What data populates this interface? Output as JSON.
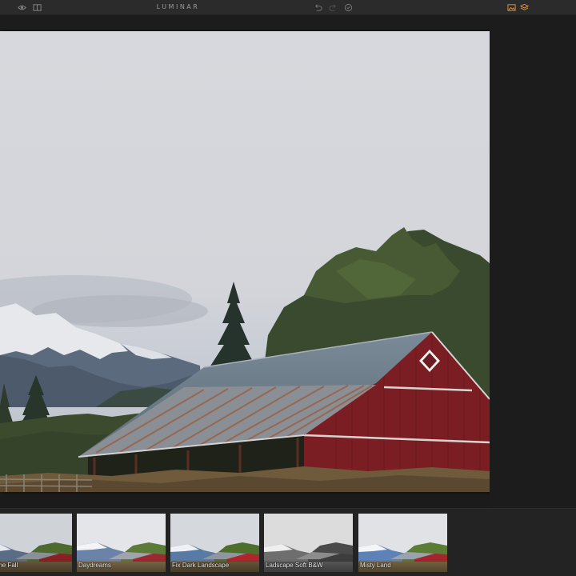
{
  "app": {
    "title": "LUMINAR"
  },
  "toolbar": {
    "icons": [
      "eye-icon",
      "compare-split-icon",
      "undo-icon",
      "redo-icon",
      "history-icon",
      "image-browser-icon",
      "layers-icon"
    ],
    "accent_color": "#e8953a"
  },
  "filmstrip": {
    "presets": [
      {
        "label": "s of the Fall"
      },
      {
        "label": "Daydreams"
      },
      {
        "label": "Fix Dark Landscape"
      },
      {
        "label": "Ladscape Soft B&W"
      },
      {
        "label": "Misty Land"
      }
    ]
  }
}
